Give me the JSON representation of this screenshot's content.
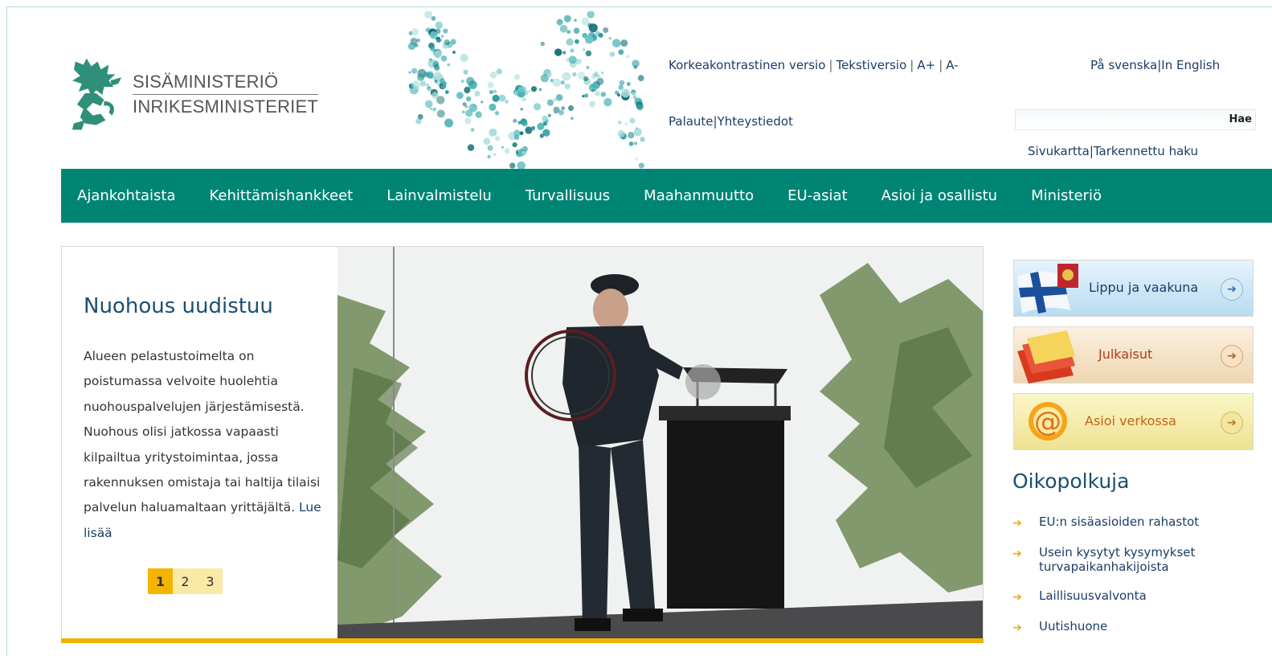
{
  "logo": {
    "line1": "SISÄMINISTERIÖ",
    "line2": "INRIKESMINISTERIET"
  },
  "header": {
    "access_links": [
      "Korkeakontrastinen versio",
      "Tekstiversio",
      "A+",
      "A-"
    ],
    "lang_links": [
      "På svenska",
      "In English"
    ],
    "feedback_links": [
      "Palaute",
      "Yhteystiedot"
    ],
    "search_button": "Hae",
    "site_links": [
      "Sivukartta",
      "Tarkennettu haku"
    ]
  },
  "nav": [
    "Ajankohtaista",
    "Kehittämishankkeet",
    "Lainvalmistelu",
    "Turvallisuus",
    "Maahanmuutto",
    "EU-asiat",
    "Asioi ja osallistu",
    "Ministeriö"
  ],
  "feature": {
    "title": "Nuohous uudistuu",
    "text": "Alueen pelastustoimelta on poistumassa velvoite huolehtia nuohouspalvelujen järjestämisestä. Nuohous olisi jatkossa vapaasti kilpailtua yritystoimintaa, jossa rakennuksen omistaja tai haltija tilaisi palvelun haluamaltaan yrittäjältä.",
    "read_more": "Lue lisää",
    "pages": [
      "1",
      "2",
      "3"
    ],
    "active_page": "1"
  },
  "banners": [
    {
      "label": "Lippu ja vaakuna",
      "color": "#1b3d66"
    },
    {
      "label": "Julkaisut",
      "color": "#b03a1a"
    },
    {
      "label": "Asioi verkossa",
      "color": "#c0651a"
    }
  ],
  "shortcuts": {
    "title": "Oikopolkuja",
    "items": [
      "EU:n sisäasioiden rahastot",
      "Usein kysytyt kysymykset turvapaikanhakijoista",
      "Laillisuusvalvonta",
      "Uutishuone"
    ]
  },
  "colors": {
    "nav_bg": "#008575",
    "accent": "#f0b400",
    "heading": "#1b4f72",
    "link": "#1b3d66"
  }
}
